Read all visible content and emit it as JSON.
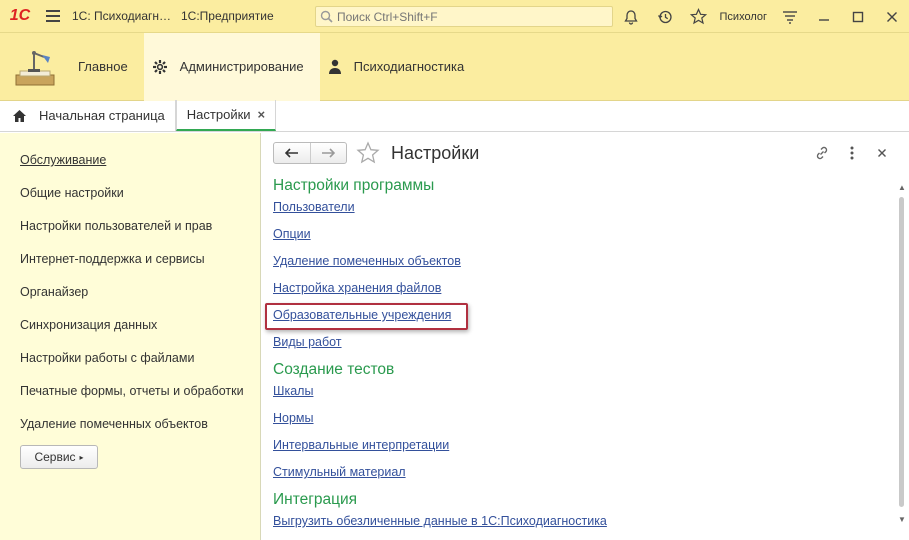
{
  "titlebar": {
    "logo": "1С",
    "title": "1С: Психодиагн…",
    "subtitle": "1С:Предприятие",
    "search_placeholder": "Поиск Ctrl+Shift+F",
    "user": "Психолог",
    "icons": [
      "bell-icon",
      "history-icon",
      "star-icon",
      "settings-icon",
      "minimize-icon",
      "maximize-icon",
      "close-icon"
    ]
  },
  "sections": {
    "items": [
      {
        "label": "Главное",
        "icon": "desk-lamp-icon"
      },
      {
        "label": "Администрирование",
        "icon": "gear-icon"
      },
      {
        "label": "Психодиагностика",
        "icon": "person-icon"
      }
    ],
    "active": "Администрирование"
  },
  "tabs": {
    "home": "Начальная страница",
    "open": [
      {
        "label": "Настройки",
        "close": "×"
      }
    ]
  },
  "sidebar": {
    "items": [
      {
        "label": "Обслуживание"
      },
      {
        "label": "Общие настройки"
      },
      {
        "label": "Настройки пользователей и прав"
      },
      {
        "label": "Интернет-поддержка и сервисы"
      },
      {
        "label": "Органайзер"
      },
      {
        "label": "Синхронизация данных"
      },
      {
        "label": "Настройки работы с файлами"
      },
      {
        "label": "Печатные формы, отчеты и обработки"
      },
      {
        "label": "Удаление помеченных объектов"
      }
    ],
    "service_button": "Сервис"
  },
  "form": {
    "title": "Настройки",
    "groups": [
      {
        "title": "Настройки программы",
        "links": [
          "Пользователи",
          "Опции",
          "Удаление помеченных объектов",
          "Настройка хранения файлов",
          "Образовательные учреждения",
          "Виды работ"
        ]
      },
      {
        "title": "Создание тестов",
        "links": [
          "Шкалы",
          "Нормы",
          "Интервальные интерпретации",
          "Стимульный материал"
        ]
      },
      {
        "title": "Интеграция",
        "links": [
          "Выгрузить обезличенные данные в 1С:Психодиагностика"
        ]
      }
    ],
    "highlighted_link": "Образовательные учреждения",
    "colors": {
      "group_title": "#2a9a4e",
      "link": "#33509b",
      "highlight_border": "#b03040",
      "sidebar_bg": "#fffdd8",
      "header_bg": "#fbeda0"
    }
  }
}
